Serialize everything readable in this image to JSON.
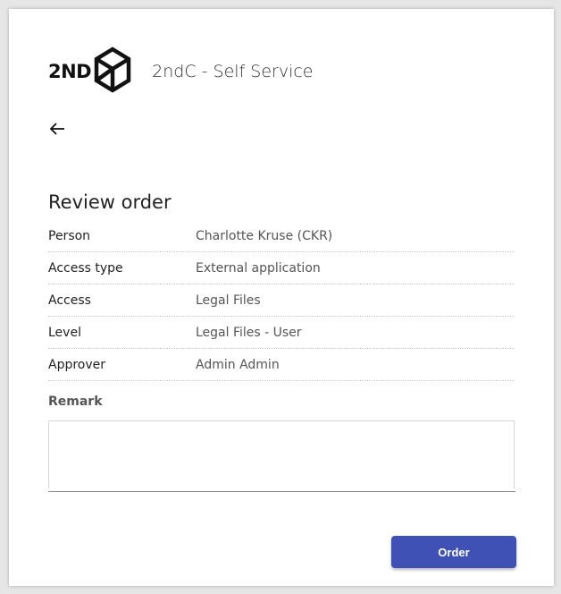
{
  "header": {
    "logo_text": "2ND",
    "app_title": "2ndC - Self Service"
  },
  "icons": {
    "back": "arrow-left-icon",
    "logo": "2ndc-cube-logo-icon"
  },
  "review": {
    "title": "Review order",
    "rows": [
      {
        "label": "Person",
        "value": "Charlotte Kruse (CKR)"
      },
      {
        "label": "Access type",
        "value": "External application"
      },
      {
        "label": "Access",
        "value": "Legal Files"
      },
      {
        "label": "Level",
        "value": "Legal Files - User"
      },
      {
        "label": "Approver",
        "value": "Admin Admin"
      }
    ]
  },
  "remark": {
    "label": "Remark",
    "value": "",
    "placeholder": ""
  },
  "actions": {
    "order_label": "Order"
  },
  "colors": {
    "primary": "#3f51b5",
    "background": "#e6e6e6",
    "card": "#ffffff"
  }
}
